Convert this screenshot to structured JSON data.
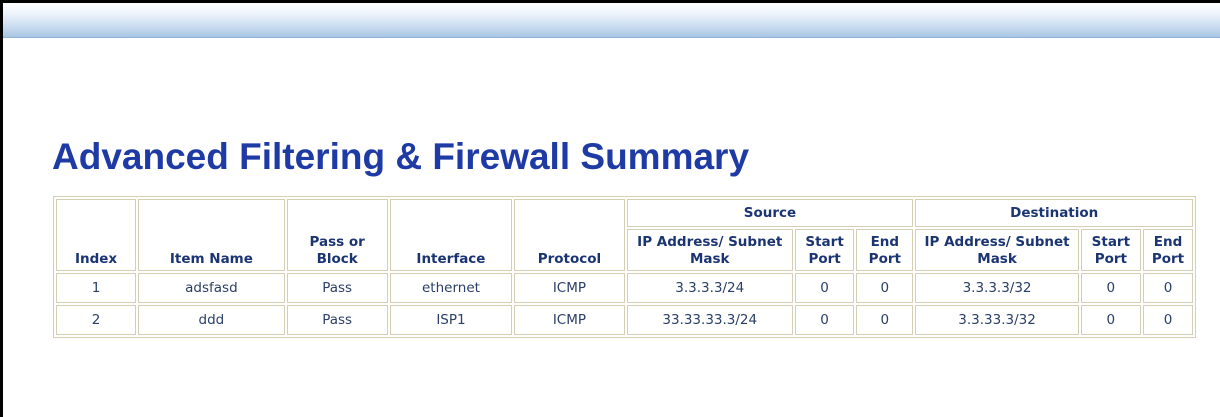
{
  "page": {
    "title": "Advanced Filtering & Firewall Summary"
  },
  "table": {
    "headers": {
      "index": "Index",
      "item_name": "Item Name",
      "pass_or_block": "Pass or Block",
      "interface": "Interface",
      "protocol": "Protocol",
      "source": "Source",
      "destination": "Destination",
      "ip_subnet": "IP Address/ Subnet Mask",
      "start_port": "Start Port",
      "end_port": "End Port"
    },
    "rows": [
      {
        "index": "1",
        "item_name": "adsfasd",
        "pass_or_block": "Pass",
        "interface": "ethernet",
        "protocol": "ICMP",
        "src_ip": "3.3.3.3/24",
        "src_start": "0",
        "src_end": "0",
        "dst_ip": "3.3.3.3/32",
        "dst_start": "0",
        "dst_end": "0"
      },
      {
        "index": "2",
        "item_name": "ddd",
        "pass_or_block": "Pass",
        "interface": "ISP1",
        "protocol": "ICMP",
        "src_ip": "33.33.33.3/24",
        "src_start": "0",
        "src_end": "0",
        "dst_ip": "3.3.33.3/32",
        "dst_start": "0",
        "dst_end": "0"
      }
    ]
  },
  "colors": {
    "title": "#1d3aa5",
    "header_text": "#1b3573",
    "cell_text": "#2a3f66",
    "border": "#d4cfb3"
  }
}
